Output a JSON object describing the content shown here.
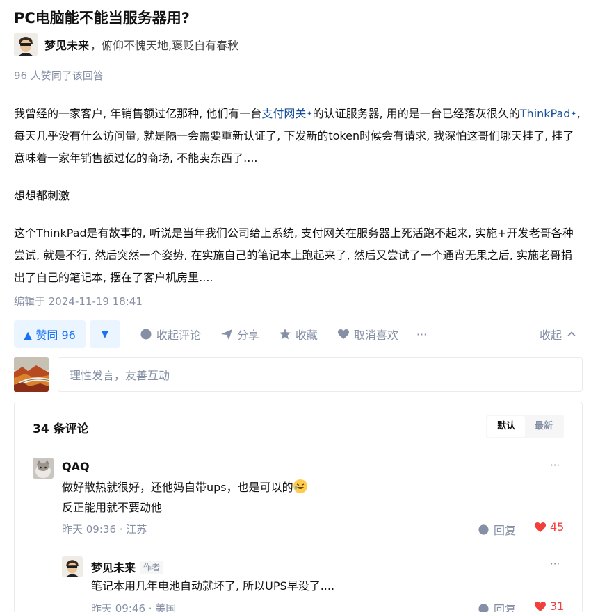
{
  "question": {
    "title": "PC电脑能不能当服务器用?"
  },
  "author": {
    "name": "梦见未来",
    "bio": "，俯仰不愧天地,褒贬自有春秋"
  },
  "voters_text": "96 人赞同了该回答",
  "content": {
    "p1_a": "我曾经的一家客户, 年销售额过亿那种, 他们有一台",
    "p1_link1": "支付网关",
    "p1_b": "的认证服务器, 用的是一台已经落灰很久的",
    "p1_link2": "ThinkPad",
    "p1_c": ", 每天几乎没有什么访问量, 就是隔一会需要重新认证了, 下发新的token时候会有请求, 我深怕这哥们哪天挂了, 挂了意味着一家年销售额过亿的商场, 不能卖东西了....",
    "p2": "想想都刺激",
    "p3": "这个ThinkPad是有故事的, 听说是当年我们公司给上系统, 支付网关在服务器上死活跑不起来, 实施+开发老哥各种尝试, 就是不行, 然后突然一个姿势, 在实施自己的笔记本上跑起来了, 然后又尝试了一个通宵无果之后, 实施老哥捐出了自己的笔记本, 摆在了客户机房里...."
  },
  "edited": "编辑于 2024-11-19 18:41",
  "actions": {
    "vote_up": "▲ 赞同 96",
    "vote_down": "▼",
    "collapse_comments": "收起评论",
    "share": "分享",
    "favorite": "收藏",
    "unlike": "取消喜欢",
    "more": "···",
    "collapse": "收起"
  },
  "reply_placeholder": "理性发言，友善互动",
  "comments": {
    "count_label": "34 条评论",
    "sort_default": "默认",
    "sort_latest": "最新",
    "items": [
      {
        "name": "QAQ",
        "line1": "做好散热就很好，还他妈自带ups，也是可以的",
        "line2": "反正能用就不要动他",
        "meta": "昨天 09:36 · 江苏",
        "reply": "回复",
        "likes": "45",
        "more": "···"
      },
      {
        "name": "梦见未来",
        "tag": "作者",
        "line1": "笔记本用几年电池自动就坏了, 所以UPS早没了....",
        "meta": "昨天 09:46 · 美国",
        "reply": "回复",
        "likes": "31",
        "more": "···"
      }
    ]
  }
}
